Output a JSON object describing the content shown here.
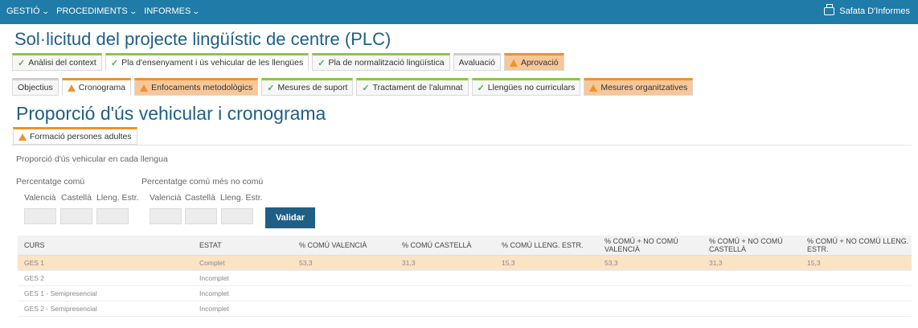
{
  "topbar": {
    "menu": [
      "GESTIÓ",
      "PROCEDIMENTS",
      "INFORMES"
    ],
    "tray_label": "Safata D'Informes"
  },
  "page_title": "Sol·licitud del projecte lingüístic de centre (PLC)",
  "main_tabs": [
    {
      "label": "Anàlisi del context",
      "status": "ok"
    },
    {
      "label": "Pla d'ensenyament i ús vehicular de les llengües",
      "status": "ok"
    },
    {
      "label": "Pla de normalització lingüística",
      "status": "ok"
    },
    {
      "label": "Avaluació",
      "status": "none"
    },
    {
      "label": "Aprovació",
      "status": "warn"
    }
  ],
  "sub_tabs": [
    {
      "label": "Objectius",
      "status": "none"
    },
    {
      "label": "Cronograma",
      "status": "warn"
    },
    {
      "label": "Enfocaments metodològics",
      "status": "warn"
    },
    {
      "label": "Mesures de suport",
      "status": "ok"
    },
    {
      "label": "Tractament de l'alumnat",
      "status": "ok"
    },
    {
      "label": "Llengües no curriculars",
      "status": "ok"
    },
    {
      "label": "Mesures organitzatives",
      "status": "warn"
    }
  ],
  "section_title": "Proporció d'ús vehicular i cronograma",
  "section_tab": "Formació persones adultes",
  "form": {
    "intro": "Proporció d'ús vehicular en cada llengua",
    "group1_label": "Percentatge comú",
    "group2_label": "Percentatge comú més no comú",
    "col_labels": [
      "Valencià",
      "Castellà",
      "Lleng. Estr."
    ],
    "validate_button": "Validar"
  },
  "table": {
    "headers": [
      "CURS",
      "ESTAT",
      "% COMÚ VALENCIÀ",
      "% COMÚ CASTELLÀ",
      "% COMÚ LLENG. ESTR.",
      "% COMÚ + NO COMÚ VALENCIÀ",
      "% COMÚ + NO COMÚ CASTELLÀ",
      "% COMÚ + NO COMÚ LLENG. ESTR."
    ],
    "rows": [
      [
        "GES 1",
        "Complet",
        "53,3",
        "31,3",
        "15,3",
        "53,3",
        "31,3",
        "15,3"
      ],
      [
        "GES 2",
        "Incomplet",
        "",
        "",
        "",
        "",
        "",
        ""
      ],
      [
        "GES 1 - Semipresencial",
        "Incomplet",
        "",
        "",
        "",
        "",
        "",
        ""
      ],
      [
        "GES 2 - Semipresencial",
        "Incomplet",
        "",
        "",
        "",
        "",
        "",
        ""
      ]
    ]
  },
  "colors": {
    "topbar": "#1f7ba7",
    "title": "#1f5f86",
    "ok": "#8dc63f",
    "warn": "#f0922b",
    "highlight_row": "#fbe3c6"
  }
}
